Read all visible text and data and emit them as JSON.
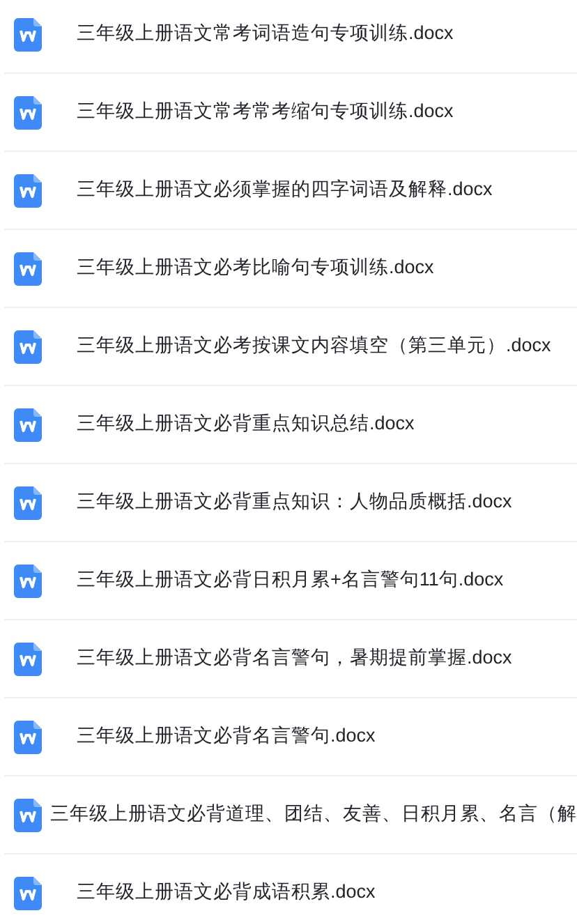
{
  "files": [
    {
      "name": "三年级上册语文常考词语造句专项训练.docx"
    },
    {
      "name": "三年级上册语文常考常考缩句专项训练.docx"
    },
    {
      "name": "三年级上册语文必须掌握的四字词语及解释.docx"
    },
    {
      "name": "三年级上册语文必考比喻句专项训练.docx"
    },
    {
      "name": "三年级上册语文必考按课文内容填空（第三单元）.docx"
    },
    {
      "name": "三年级上册语文必背重点知识总结.docx"
    },
    {
      "name": "三年级上册语文必背重点知识：人物品质概括.docx"
    },
    {
      "name": "三年级上册语文必背日积月累+名言警句11句.docx"
    },
    {
      "name": "三年级上册语文必背名言警句，暑期提前掌握.docx"
    },
    {
      "name": "三年级上册语文必背名言警句.docx"
    },
    {
      "name": "三年级上册语文必背道理、团结、友善、日积月累、名言（解"
    },
    {
      "name": "三年级上册语文必背成语积累.docx"
    }
  ]
}
